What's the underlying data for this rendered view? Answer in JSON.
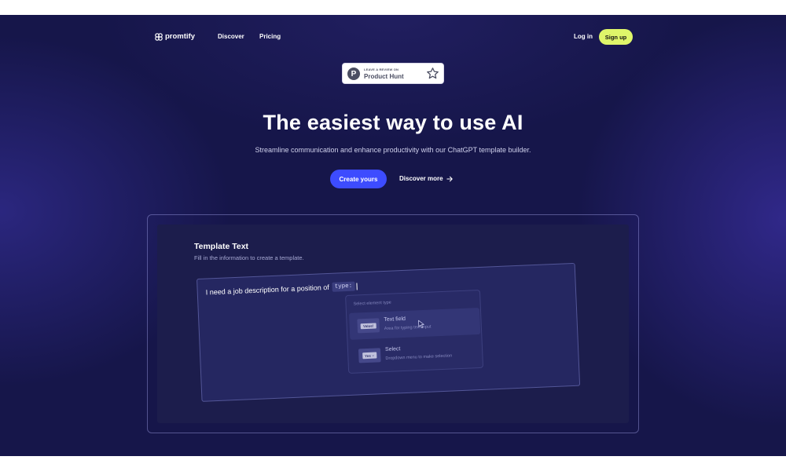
{
  "nav": {
    "brand": "promtify",
    "links": [
      {
        "label": "Discover"
      },
      {
        "label": "Pricing"
      }
    ],
    "login_label": "Log in",
    "signup_label": "Sign up"
  },
  "badge": {
    "kicker": "LEAVE A REVIEW ON",
    "name": "Product Hunt",
    "letter": "P",
    "icon": "star-icon"
  },
  "hero": {
    "title": "The easiest way to use AI",
    "subtitle": "Streamline communication and enhance productivity with our ChatGPT template builder.",
    "primary_cta": "Create yours",
    "secondary_cta": "Discover more"
  },
  "demo": {
    "title": "Template Text",
    "subtitle": "Fill in the information to create a template.",
    "editor_text": "I need a job description for a position of",
    "variable_chip": "type: ",
    "dropdown": {
      "header": "Select element type",
      "items": [
        {
          "label": "Text field",
          "description": "Area for typing text input",
          "thumb": "Value!"
        },
        {
          "label": "Select",
          "description": "Dropdown menu to make selection",
          "thumb": "Yes"
        }
      ]
    }
  },
  "colors": {
    "background": "#16164a",
    "signup": "#dff66a",
    "primary": "#3d4cff",
    "panel": "#1c1d4c"
  }
}
